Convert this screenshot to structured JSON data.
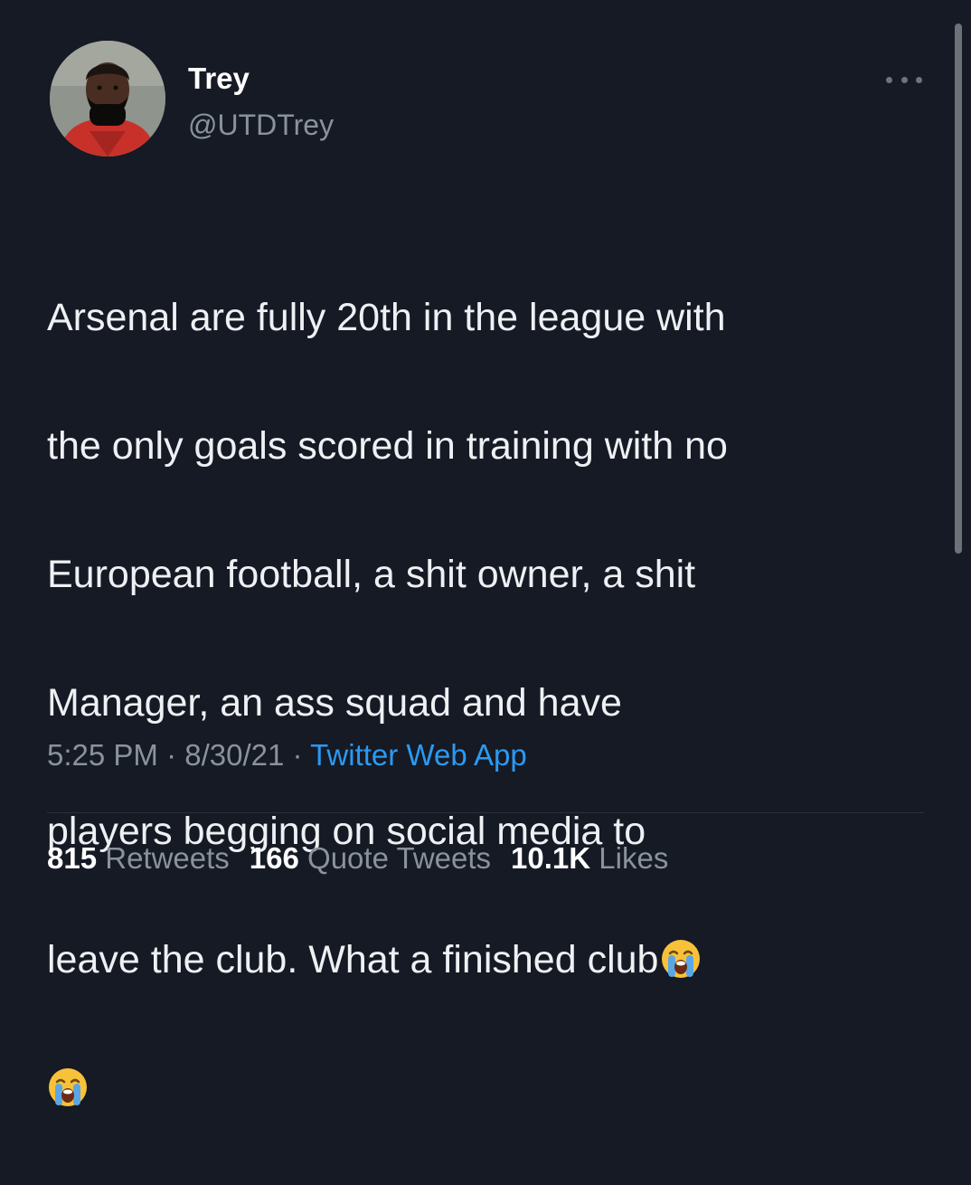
{
  "author": {
    "display_name": "Trey",
    "handle": "@UTDTrey",
    "avatar_icon": "avatar-photo-icon"
  },
  "tweet": {
    "lines": [
      "Arsenal are fully 20th in the league with",
      "the only goals scored in training with no",
      "European football, a shit owner, a shit",
      "Manager, an ass squad and have",
      "players begging on social media to",
      "leave the club. What a finished club"
    ],
    "emoji_icon": "loudly-crying-face-icon",
    "emoji_char": "😭"
  },
  "meta": {
    "time": "5:25 PM",
    "separator": " · ",
    "date": "8/30/21",
    "source": "Twitter Web App"
  },
  "stats": {
    "retweets_count": "815",
    "retweets_label": "Retweets",
    "quotes_count": "166",
    "quotes_label": "Quote Tweets",
    "likes_count": "10.1K",
    "likes_label": "Likes"
  },
  "colors": {
    "background": "#151a25",
    "text": "#eef0f3",
    "muted": "#8a929c",
    "link": "#2b9af3"
  }
}
